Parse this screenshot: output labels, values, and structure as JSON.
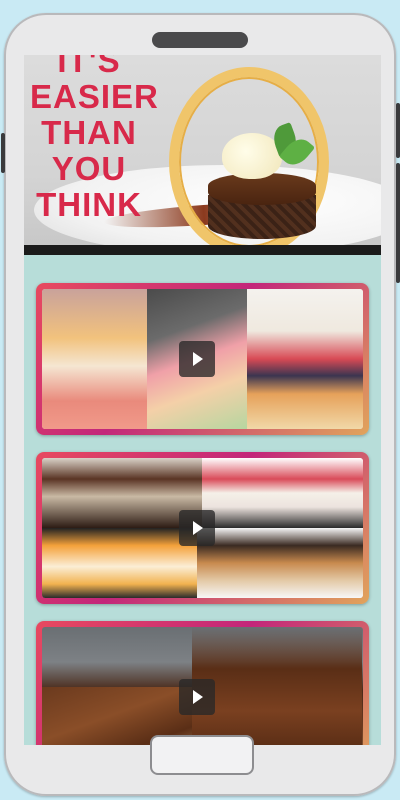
{
  "hero": {
    "title": "IT'S\nEASIER\nTHAN\nYOU\nTHINK"
  },
  "feed": {
    "items": [
      {
        "name": "video-card-1",
        "play_icon": "play-icon"
      },
      {
        "name": "video-card-2",
        "play_icon": "play-icon"
      },
      {
        "name": "video-card-3",
        "play_icon": "play-icon"
      }
    ]
  },
  "colors": {
    "accent": "#d8294a",
    "card_gradient_start": "#e84a5f",
    "card_gradient_mid": "#c3267a",
    "card_gradient_end": "#e1a45b",
    "screen_background": "#b7ddd9",
    "page_background": "#c9eaf4"
  }
}
